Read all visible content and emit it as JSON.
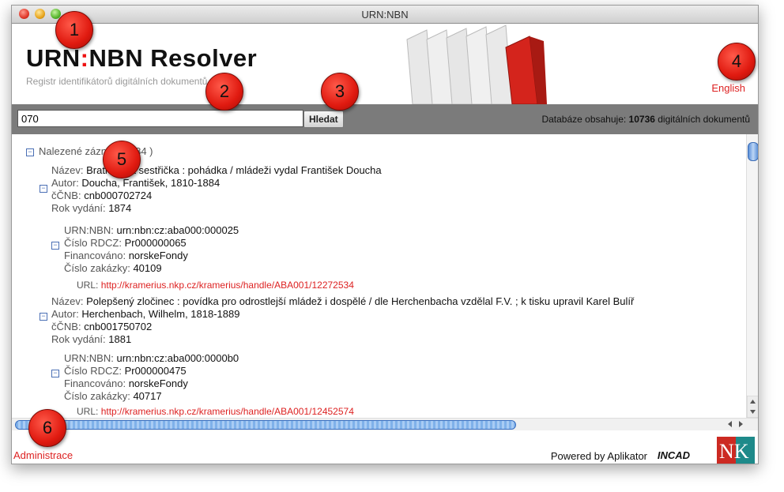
{
  "window": {
    "title": "URN:NBN"
  },
  "header": {
    "logo_part1": "URN",
    "logo_colon": ":",
    "logo_part2": "NBN Resolver",
    "subtitle": "Registr identifikátorů digitálních dokumentů",
    "language_link": "English"
  },
  "search": {
    "value": "070",
    "button_label": "Hledat",
    "db_prefix": "Databáze obsahuje: ",
    "db_count": "10736",
    "db_suffix": " digitálních dokumentů"
  },
  "results": {
    "heading": "Nalezené záznamy ( 84 )",
    "records": [
      {
        "nazev_label": "Název:",
        "nazev": "Bratříček a sestřička : pohádka / mládeži vydal František Doucha",
        "autor_label": "Autor:",
        "autor": "Doucha, František, 1810-1884",
        "ccnb_label": "čČNB:",
        "ccnb": "cnb000702724",
        "rok_label": "Rok vydání:",
        "rok": "1874",
        "urn_label": "URN:NBN:",
        "urn": "urn:nbn:cz:aba000:000025",
        "rdcz_label": "Číslo RDCZ:",
        "rdcz": "Pr000000065",
        "fin_label": "Financováno:",
        "fin": "norskeFondy",
        "zak_label": "Číslo zakázky:",
        "zak": "40109",
        "url_label": "URL:",
        "url": "http://kramerius.nkp.cz/kramerius/handle/ABA001/12272534"
      },
      {
        "nazev_label": "Název:",
        "nazev": "Polepšený zločinec : povídka pro odrostlejší mládež i dospělé / dle Herchenbacha vzdělal F.V. ; k tisku upravil Karel Bulíř",
        "autor_label": "Autor:",
        "autor": "Herchenbach, Wilhelm, 1818-1889",
        "ccnb_label": "čČNB:",
        "ccnb": "cnb001750702",
        "rok_label": "Rok vydání:",
        "rok": "1881",
        "urn_label": "URN:NBN:",
        "urn": "urn:nbn:cz:aba000:0000b0",
        "rdcz_label": "Číslo RDCZ:",
        "rdcz": "Pr000000475",
        "fin_label": "Financováno:",
        "fin": "norskeFondy",
        "zak_label": "Číslo zakázky:",
        "zak": "40717",
        "url_label": "URL:",
        "url": "http://kramerius.nkp.cz/kramerius/handle/ABA001/12452574"
      }
    ]
  },
  "footer": {
    "admin_link": "Administrace",
    "powered_by": "Powered by Aplikator",
    "incad_logo": "INCAD",
    "nk_logo": "NK"
  },
  "callouts": [
    "1",
    "2",
    "3",
    "4",
    "5",
    "6"
  ],
  "colors": {
    "accent": "#dd2222",
    "searchbar": "#7b7b7b",
    "callout": "#e01a10"
  }
}
